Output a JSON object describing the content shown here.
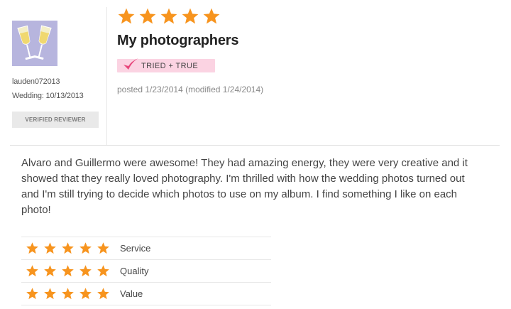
{
  "reviewer": {
    "avatar_icon": "champagne-glasses-icon",
    "username": "lauden072013",
    "wedding_date": "Wedding: 10/13/2013",
    "verified_label": "VERIFIED REVIEWER"
  },
  "review": {
    "overall_rating": 5,
    "title": "My photographers",
    "badge_label": "TRIED + TRUE",
    "posted": "posted 1/23/2014 (modified 1/24/2014)",
    "body": "Alvaro and Guillermo were awesome! They had amazing energy, they were very creative and it showed that they really loved photography. I'm thrilled with how the wedding photos turned out and I'm still trying to decide which photos to use on my album. I find something I like on each photo!"
  },
  "ratings": [
    {
      "label": "Service",
      "value": 5
    },
    {
      "label": "Quality",
      "value": 5
    },
    {
      "label": "Value",
      "value": 5
    }
  ],
  "colors": {
    "star": "#f7941e",
    "badge_bg": "#fbd3e2",
    "check": "#e8477c",
    "avatar_bg": "#b7b5de"
  }
}
